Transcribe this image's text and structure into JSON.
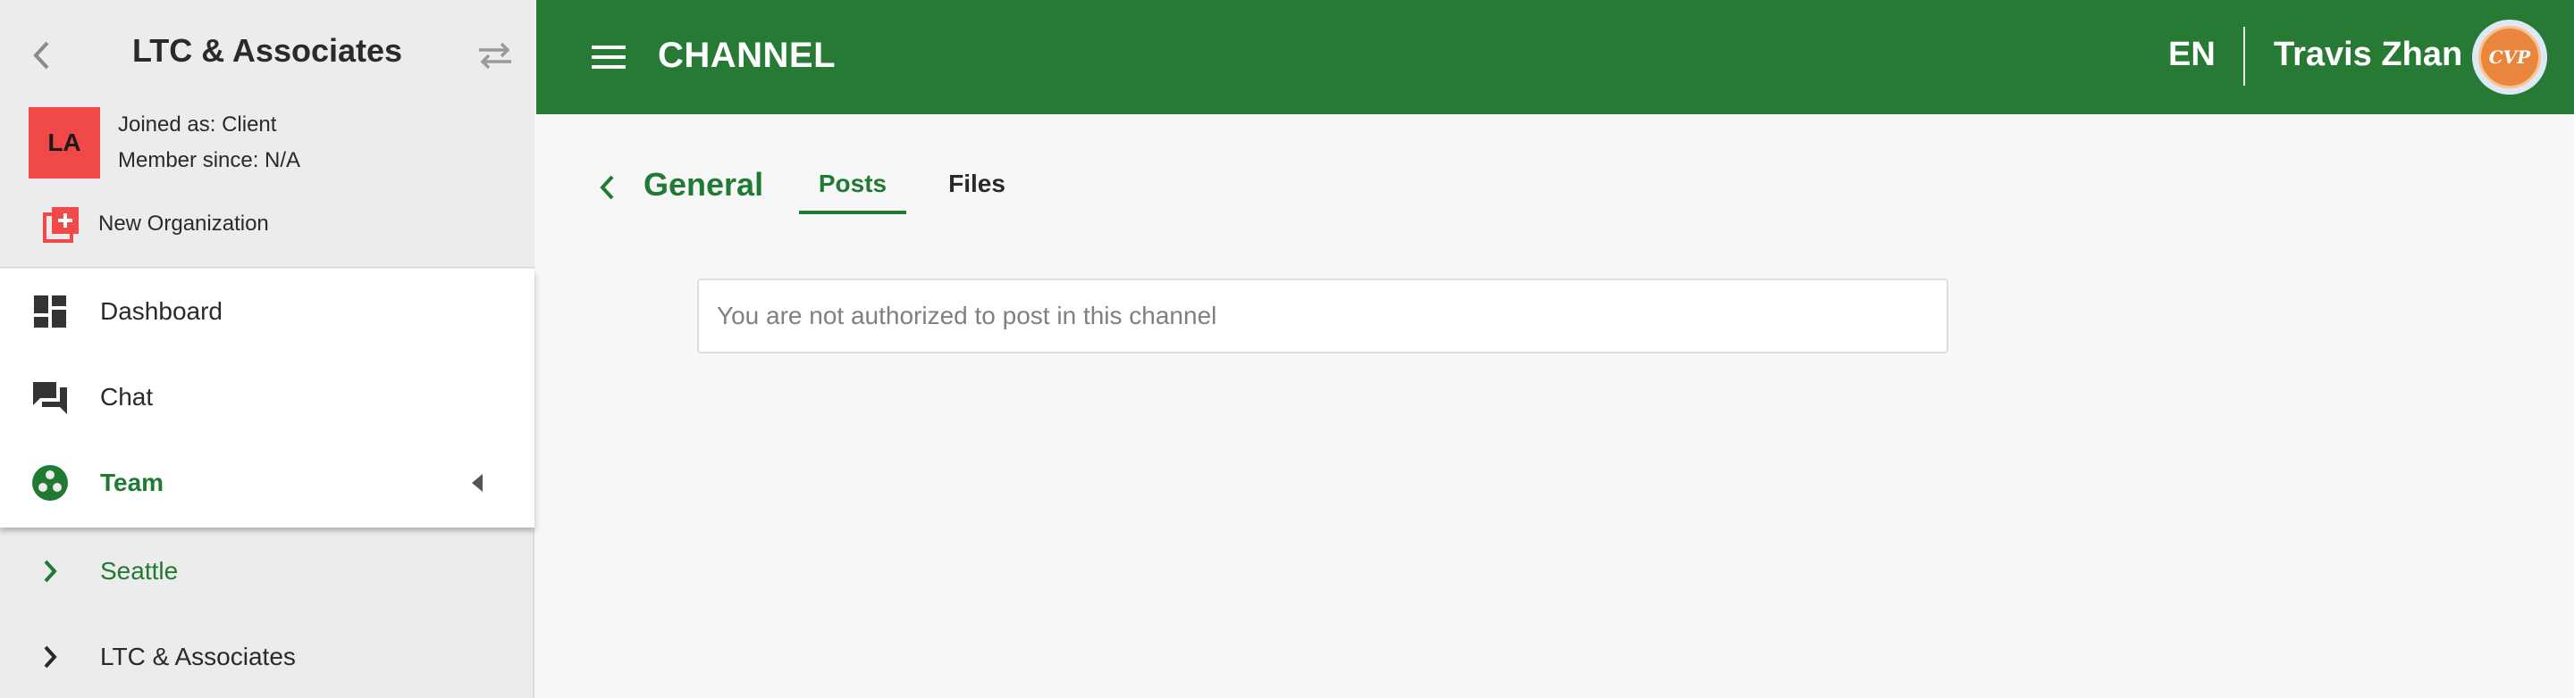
{
  "organization": {
    "name": "LTC & Associates",
    "initials": "LA",
    "joined_as": "Joined as: Client",
    "member_since": "Member since: N/A",
    "new_org_label": "New Organization",
    "avatar_color": "#f14848"
  },
  "sidebar": {
    "nav": [
      {
        "label": "Dashboard",
        "icon": "dashboard-icon"
      },
      {
        "label": "Chat",
        "icon": "chat-icon"
      },
      {
        "label": "Team",
        "icon": "team-icon",
        "active": true,
        "expanded": true
      }
    ],
    "sub_items": [
      {
        "label": "Seattle",
        "color": "#217a34"
      },
      {
        "label": "LTC & Associates",
        "color": "#2a2a2a"
      }
    ]
  },
  "topbar": {
    "title": "CHANNEL",
    "language": "EN",
    "user_name": "Travis Zhan",
    "avatar_text": "CVP",
    "background": "#277a33"
  },
  "channel": {
    "name": "General",
    "tabs": [
      {
        "label": "Posts",
        "active": true
      },
      {
        "label": "Files",
        "active": false
      }
    ],
    "post_notice": "You are not authorized to post in this channel"
  },
  "colors": {
    "accent": "#217a34",
    "sidebar_bg": "#ececec",
    "content_bg": "#f7f7f7"
  }
}
